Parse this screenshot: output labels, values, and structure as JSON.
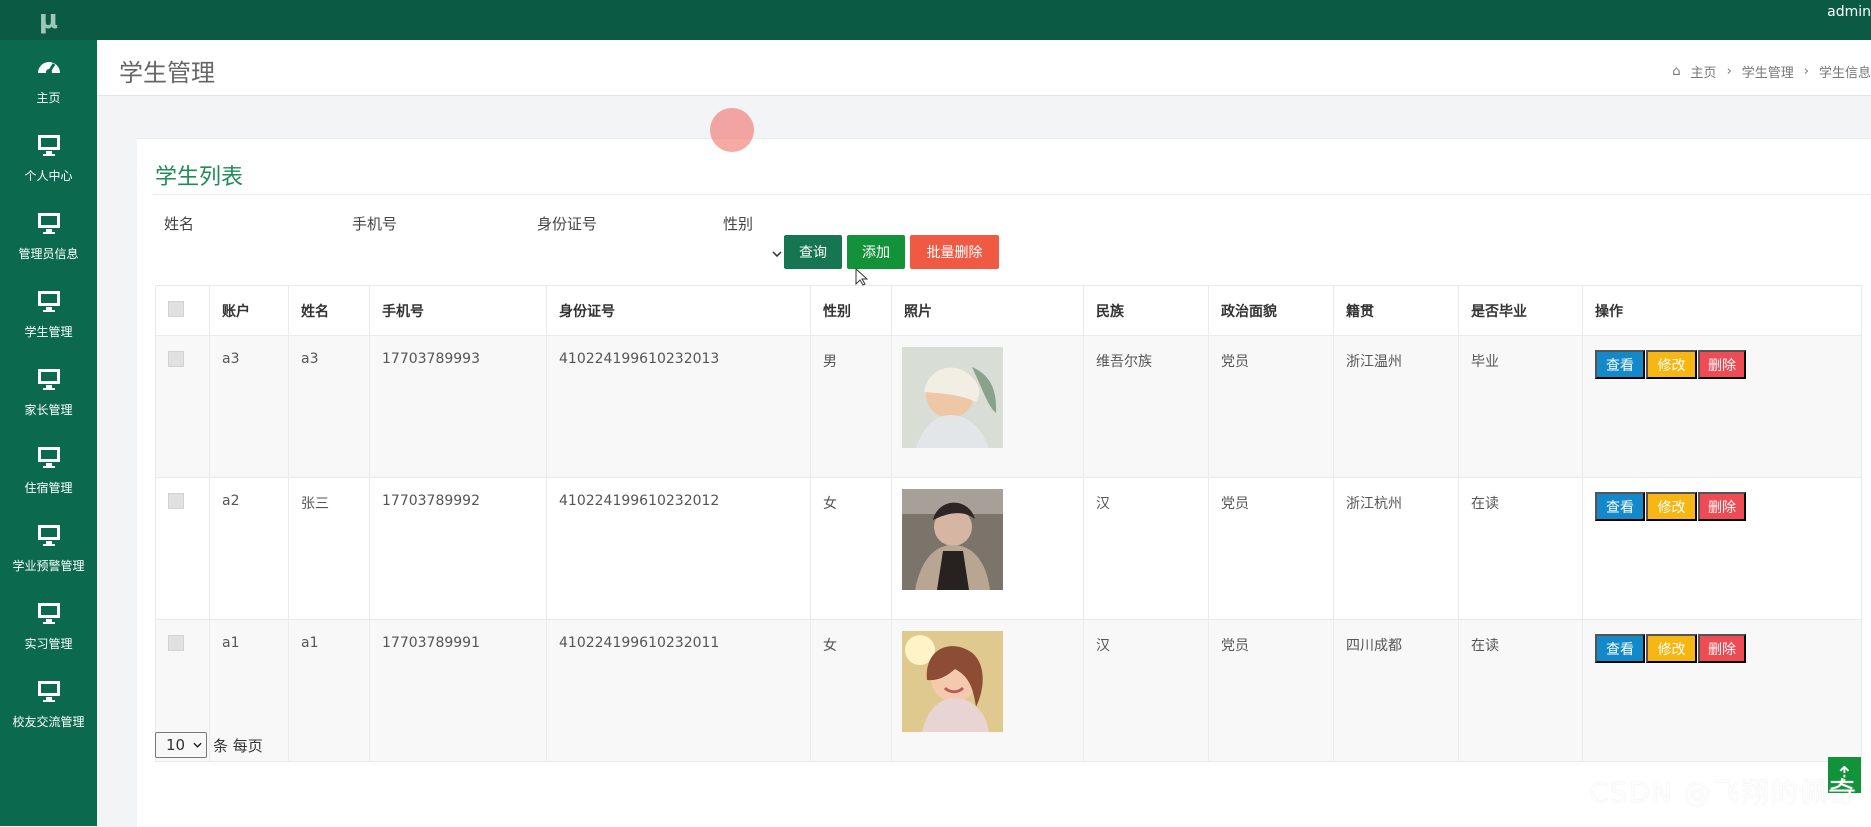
{
  "topbar": {
    "logo": "μ",
    "user": "admin"
  },
  "sidebar": {
    "items": [
      {
        "label": "主页",
        "icon": "dashboard-icon"
      },
      {
        "label": "个人中心",
        "icon": "monitor-icon"
      },
      {
        "label": "管理员信息",
        "icon": "monitor-icon"
      },
      {
        "label": "学生管理",
        "icon": "monitor-icon"
      },
      {
        "label": "家长管理",
        "icon": "monitor-icon"
      },
      {
        "label": "住宿管理",
        "icon": "monitor-icon"
      },
      {
        "label": "学业预警管理",
        "icon": "monitor-icon"
      },
      {
        "label": "实习管理",
        "icon": "monitor-icon"
      },
      {
        "label": "校友交流管理",
        "icon": "monitor-icon"
      }
    ]
  },
  "header": {
    "title": "学生管理",
    "breadcrumb": [
      "主页",
      "学生管理",
      "学生信息"
    ]
  },
  "card": {
    "title": "学生列表"
  },
  "search": {
    "labels": [
      "姓名",
      "手机号",
      "身份证号",
      "性别"
    ],
    "buttons": {
      "query": "查询",
      "add": "添加",
      "batch_delete": "批量删除"
    }
  },
  "table": {
    "headers": [
      "账户",
      "姓名",
      "手机号",
      "身份证号",
      "性别",
      "照片",
      "民族",
      "政治面貌",
      "籍贯",
      "是否毕业",
      "操作"
    ],
    "rows": [
      {
        "account": "a3",
        "name": "a3",
        "phone": "17703789993",
        "id_card": "410224199610232013",
        "gender": "男",
        "ethnicity": "维吾尔族",
        "political_status": "党员",
        "native_place": "浙江温州",
        "graduation": "毕业"
      },
      {
        "account": "a2",
        "name": "张三",
        "phone": "17703789992",
        "id_card": "410224199610232012",
        "gender": "女",
        "ethnicity": "汉",
        "political_status": "党员",
        "native_place": "浙江杭州",
        "graduation": "在读"
      },
      {
        "account": "a1",
        "name": "a1",
        "phone": "17703789991",
        "id_card": "410224199610232011",
        "gender": "女",
        "ethnicity": "汉",
        "political_status": "党员",
        "native_place": "四川成都",
        "graduation": "在读"
      }
    ],
    "actions": {
      "view": "查看",
      "edit": "修改",
      "delete": "删除"
    }
  },
  "pagination": {
    "per_page": "10",
    "suffix": "条 每页"
  },
  "watermark": "CSDN @飞翔的佩奇",
  "colors": {
    "sidebar": "#0b6a4d",
    "accent": "#1f8b57",
    "danger": "#ef4b55",
    "warning": "#f7b612",
    "info": "#1489c9"
  }
}
